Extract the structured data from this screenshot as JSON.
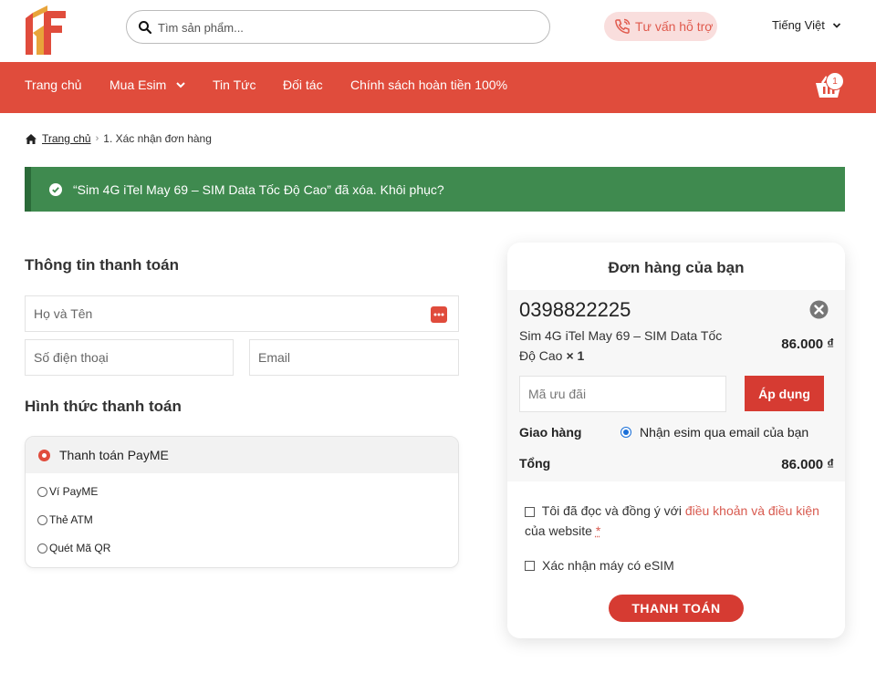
{
  "header": {
    "search_placeholder": "Tìm sản phẩm...",
    "support_label": "Tư vấn hỗ trợ",
    "language": "Tiếng Việt",
    "cart_count": "1"
  },
  "nav": {
    "items": [
      "Trang chủ",
      "Mua Esim",
      "Tin Tức",
      "Đối tác",
      "Chính sách hoàn tiền 100%"
    ]
  },
  "breadcrumb": {
    "home": "Trang chủ",
    "separator": "›",
    "current": "1. Xác nhận đơn hàng"
  },
  "notice": {
    "text": "“Sim 4G iTel May 69 – SIM Data Tốc Độ Cao” đã xóa. Khôi phục?"
  },
  "billing": {
    "title": "Thông tin thanh toán",
    "name_placeholder": "Họ và Tên",
    "phone_placeholder": "Số điện thoại",
    "email_placeholder": "Email"
  },
  "payment": {
    "title": "Hình thức thanh toán",
    "selected": "Thanh toán PayME",
    "options": [
      "Ví PayME",
      "Thẻ ATM",
      "Quét Mã QR"
    ]
  },
  "order": {
    "title": "Đơn hàng của bạn",
    "phone_number": "0398822225",
    "product_name": "Sim 4G iTel May 69 – SIM Data Tốc Độ Cao",
    "quantity": "× 1",
    "price": "86.000 ₫",
    "promo_placeholder": "Mã ưu đãi",
    "apply_label": "Áp dụng",
    "shipping_label": "Giao hàng",
    "shipping_option": "Nhận esim qua email của bạn",
    "total_label": "Tổng",
    "total_value": "86.000 ₫",
    "terms_prefix": "Tôi đã đọc và đồng ý với ",
    "terms_link": "điều khoản và điều kiện",
    "terms_suffix": " của website ",
    "terms_required": "*",
    "esim_confirm": "Xác nhận máy có eSIM",
    "pay_label": "THANH TOÁN"
  },
  "colors": {
    "brand_red": "#e04c3c",
    "button_red": "#d63b32",
    "notice_green": "#3f8a4f",
    "link_red": "#d85a4f",
    "radio_blue": "#1a6fd8"
  }
}
